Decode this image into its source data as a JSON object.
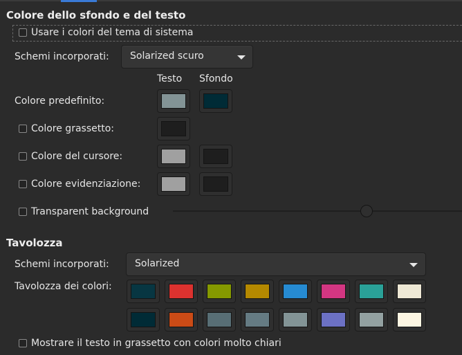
{
  "section_colors": {
    "title": "Colore dello sfondo e del testo",
    "use_system_theme_label": "Usare i colori del tema di sistema",
    "schemes_label": "Schemi incorporati:",
    "schemes_value": "Solarized scuro",
    "col_text": "Testo",
    "col_bg": "Sfondo",
    "default_color_label": "Colore predefinito:",
    "default_text_color": "#839496",
    "default_bg_color": "#002b36",
    "bold_color_label": "Colore grassetto:",
    "bold_color": "#1e1e1e",
    "cursor_color_label": "Colore del cursore:",
    "cursor_text_color": "#a0a0a0",
    "cursor_bg_color": "#1e1e1e",
    "highlight_color_label": "Colore evidenziazione:",
    "highlight_text_color": "#a0a0a0",
    "highlight_bg_color": "#1e1e1e",
    "transparent_label": "Transparent background",
    "transparency_level": 0.67
  },
  "section_palette": {
    "title": "Tavolozza",
    "schemes_label": "Schemi incorporati:",
    "schemes_value": "Solarized",
    "palette_label": "Tavolozza dei colori:",
    "row1": [
      "#073642",
      "#dc322f",
      "#859900",
      "#b58900",
      "#268bd2",
      "#d33682",
      "#2aa198",
      "#eee8d5"
    ],
    "row2": [
      "#002b36",
      "#cb4b16",
      "#586e75",
      "#657b83",
      "#839496",
      "#6c71c4",
      "#93a1a1",
      "#fdf6e3"
    ],
    "bold_bright_label": "Mostrare il testo in grassetto con colori molto chiari"
  }
}
